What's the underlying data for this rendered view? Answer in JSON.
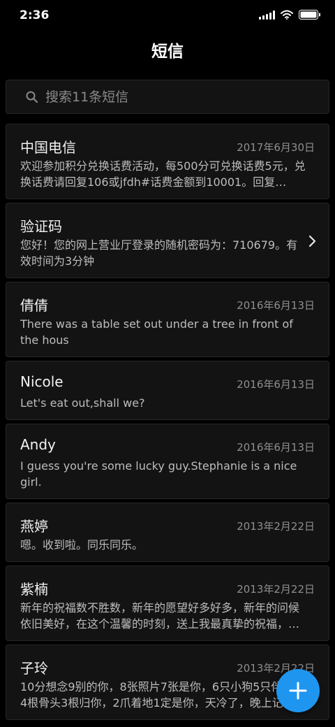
{
  "status_bar": {
    "time": "2:36"
  },
  "header": {
    "title": "短信"
  },
  "search": {
    "placeholder": "搜索11条短信"
  },
  "messages": [
    {
      "name": "中国电信",
      "date": "2017年6月30日",
      "preview": "欢迎参加积分兑换话费活动，每500分可兑换话费5元，兑换话费请回复106或jfdh#话费金额到10001。回复…"
    },
    {
      "name": "验证码",
      "date": "",
      "preview": "您好！您的网上营业厅登录的随机密码为：710679。有效时间为3分钟"
    },
    {
      "name": "倩倩",
      "date": "2016年6月13日",
      "preview": "There was a table set out under a tree in front of the hous"
    },
    {
      "name": "Nicole",
      "date": "2016年6月13日",
      "preview": "Let's eat out,shall we?"
    },
    {
      "name": "Andy",
      "date": "2016年6月13日",
      "preview": "I guess you're some lucky guy.Stephanie is a nice girl."
    },
    {
      "name": "燕婷",
      "date": "2013年2月22日",
      "preview": "嗯。收到啦。同乐同乐。"
    },
    {
      "name": "紫楠",
      "date": "2013年2月22日",
      "preview": "新年的祝福数不胜数，新年的愿望好多好多，新年的问候依旧美好，在这个温馨的时刻，送上我最真挚的祝福，…"
    },
    {
      "name": "子玲",
      "date": "2013年2月22日",
      "preview": "10分想念9别的你，8张照片7张是你，6只小狗5只伴你，4根骨头3根归你，2爪着地1定是你，天冷了，晚上记得…"
    }
  ],
  "colors": {
    "accent": "#1e96f0",
    "card": "#131313",
    "background": "#000000"
  }
}
